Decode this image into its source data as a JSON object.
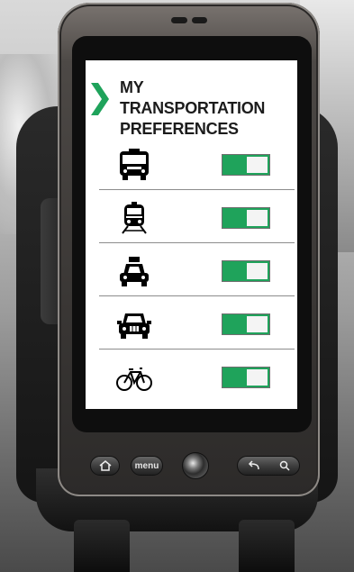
{
  "screen": {
    "title_line1": "MY TRANSPORTATION",
    "title_line2": "PREFERENCES",
    "accent_color": "#1fa35b",
    "preferences": [
      {
        "icon": "bus-icon",
        "enabled": true
      },
      {
        "icon": "train-icon",
        "enabled": true
      },
      {
        "icon": "taxi-icon",
        "enabled": true
      },
      {
        "icon": "car-icon",
        "enabled": true
      },
      {
        "icon": "bicycle-icon",
        "enabled": true
      }
    ]
  },
  "device": {
    "buttons": {
      "home": "home-icon",
      "menu": "menu",
      "back": "back-arrow-icon",
      "search": "search-icon"
    }
  }
}
